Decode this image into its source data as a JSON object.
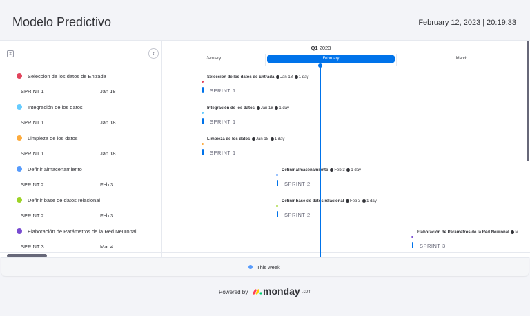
{
  "header": {
    "title": "Modelo Predictivo",
    "datetime": "February 12, 2023 | 20:19:33"
  },
  "timeline": {
    "quarter_label": "Q1",
    "quarter_year": "2023",
    "months": [
      {
        "label": "January",
        "active": false
      },
      {
        "label": "February",
        "active": true
      },
      {
        "label": "March",
        "active": false
      }
    ]
  },
  "icons": {
    "collapse": "collapse-icon",
    "back": "chevron-left-icon",
    "legend": "dot-icon"
  },
  "tasks": [
    {
      "name": "Seleccion de los datos de Entrada",
      "color": "#e2445c",
      "sprint": "SPRINT 1",
      "date": "Jan 18",
      "bar_label": "Seleccion de los datos de Entrada",
      "bar_date": "Jan 18",
      "bar_duration": "1 day",
      "bar_sprint": "SPRINT 1"
    },
    {
      "name": "Integración de los datos",
      "color": "#66ccff",
      "sprint": "SPRINT 1",
      "date": "Jan 18",
      "bar_label": "Integración de los datos",
      "bar_date": "Jan 18",
      "bar_duration": "1 day",
      "bar_sprint": "SPRINT 1"
    },
    {
      "name": "Limpieza de los datos",
      "color": "#fdab3d",
      "sprint": "SPRINT 1",
      "date": "Jan 18",
      "bar_label": "Limpieza de los datos",
      "bar_date": "Jan 18",
      "bar_duration": "1 day",
      "bar_sprint": "SPRINT 1"
    },
    {
      "name": "Definir almacenamiento",
      "color": "#579bfc",
      "sprint": "SPRINT 2",
      "date": "Feb 3",
      "bar_label": "Definir almacenamiento",
      "bar_date": "Feb 3",
      "bar_duration": "1 day",
      "bar_sprint": "SPRINT 2"
    },
    {
      "name": "Definir base de datos relacional",
      "color": "#9cd326",
      "sprint": "SPRINT 2",
      "date": "Feb 3",
      "bar_label": "Definir base de datos relacional",
      "bar_date": "Feb 3",
      "bar_duration": "1 day",
      "bar_sprint": "SPRINT 2"
    },
    {
      "name": "Elaboración de Parámetros de la Red Neuronal",
      "color": "#784bd1",
      "sprint": "SPRINT 3",
      "date": "Mar 4",
      "bar_label": "Elaboración de Parámetros de la Red Neuronal",
      "bar_date": "M",
      "bar_duration": "",
      "bar_sprint": "SPRINT 3"
    }
  ],
  "legend": {
    "label": "This week",
    "color": "#579bfc"
  },
  "footer": {
    "powered_by": "Powered by",
    "brand": "monday",
    "brand_suffix": ".com"
  },
  "colors": {
    "accent": "#0073ea",
    "text": "#323338",
    "muted": "#676879"
  }
}
